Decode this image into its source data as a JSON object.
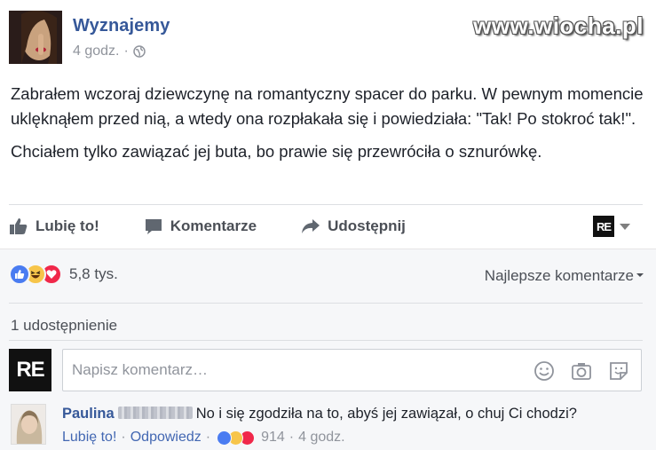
{
  "watermark": "www.wiocha.pl",
  "post": {
    "page_name": "Wyznajemy",
    "time": "4 godz.",
    "separator": "·",
    "paragraphs": [
      "Zabrałem wczoraj dziewczynę na romantyczny spacer do parku. W pewnym momencie uklęknąłem przed nią, a wtedy ona rozpłakała się i powiedziała: \"Tak! Po stokroć tak!\".",
      "Chciałem tylko zawiązać jej buta, bo prawie się przewróciła o sznurówkę."
    ]
  },
  "actions": {
    "like": "Lubię to!",
    "comment": "Komentarze",
    "share": "Udostępnij",
    "page_badge": "RE"
  },
  "feedback": {
    "reaction_icons": [
      "like-icon",
      "haha-icon",
      "love-icon"
    ],
    "reaction_count": "5,8 tys.",
    "sort_label": "Najlepsze komentarze",
    "shares_label": "1 udostępnienie",
    "composer_badge": "RE",
    "composer_placeholder": "Napisz komentarz…"
  },
  "comments": [
    {
      "author": "Paulina",
      "text": "No i się zgodziła na to, abyś jej zawiązał, o chuj Ci chodzi?",
      "like_label": "Lubię to!",
      "reply_label": "Odpowiedz",
      "reaction_count": "914",
      "time": "4 godz.",
      "separator": "·"
    }
  ],
  "colors": {
    "link": "#365899",
    "like_blue": "#4a7cf1",
    "love_red": "#f0284a",
    "haha_yellow": "#f7c54a"
  }
}
